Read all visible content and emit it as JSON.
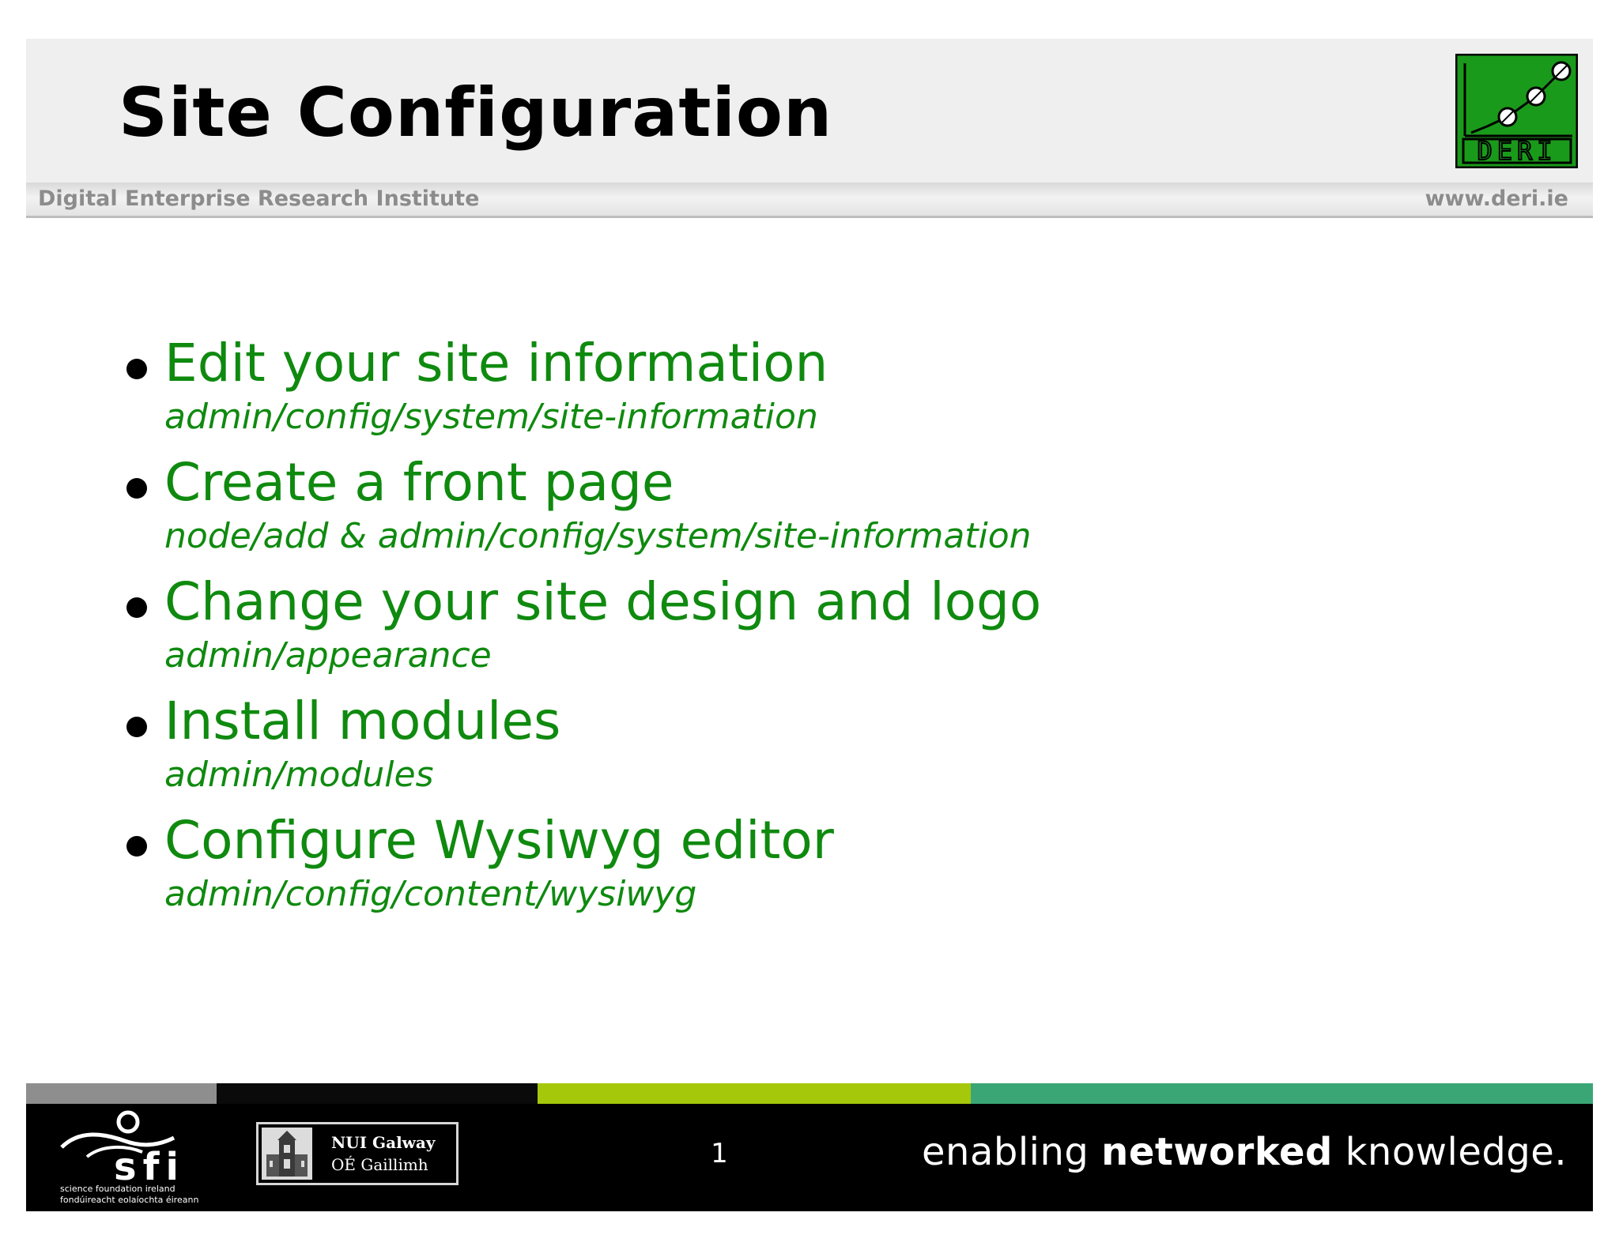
{
  "header": {
    "title": "Site Configuration",
    "institute": "Digital Enterprise Research Institute",
    "website": "www.deri.ie",
    "logo_text": "DERI"
  },
  "bullets": [
    {
      "title": "Edit your site information",
      "path": "admin/config/system/site-information"
    },
    {
      "title": "Create a front page",
      "path": "node/add & admin/config/system/site-information"
    },
    {
      "title": "Change your site design and logo",
      "path": "admin/appearance"
    },
    {
      "title": "Install modules",
      "path": "admin/modules"
    },
    {
      "title": "Configure Wysiwyg editor",
      "path": "admin/config/content/wysiwyg"
    }
  ],
  "footer": {
    "sfi_logo_text": "sfi",
    "sfi_line1": "science foundation ireland",
    "sfi_line2": "fondúireacht eolaíochta éireann",
    "nui_name": "NUI Galway",
    "nui_irish": "OÉ Gaillimh",
    "page_number": "1",
    "tagline_pre": "enabling ",
    "tagline_bold": "networked",
    "tagline_post": " knowledge."
  },
  "colors": {
    "accent_green": "#0f8a0f",
    "logo_green": "#1a9a1a",
    "stripe_gray": "#8e8e8e",
    "stripe_lime": "#a6c80b",
    "stripe_green": "#3aa676"
  }
}
